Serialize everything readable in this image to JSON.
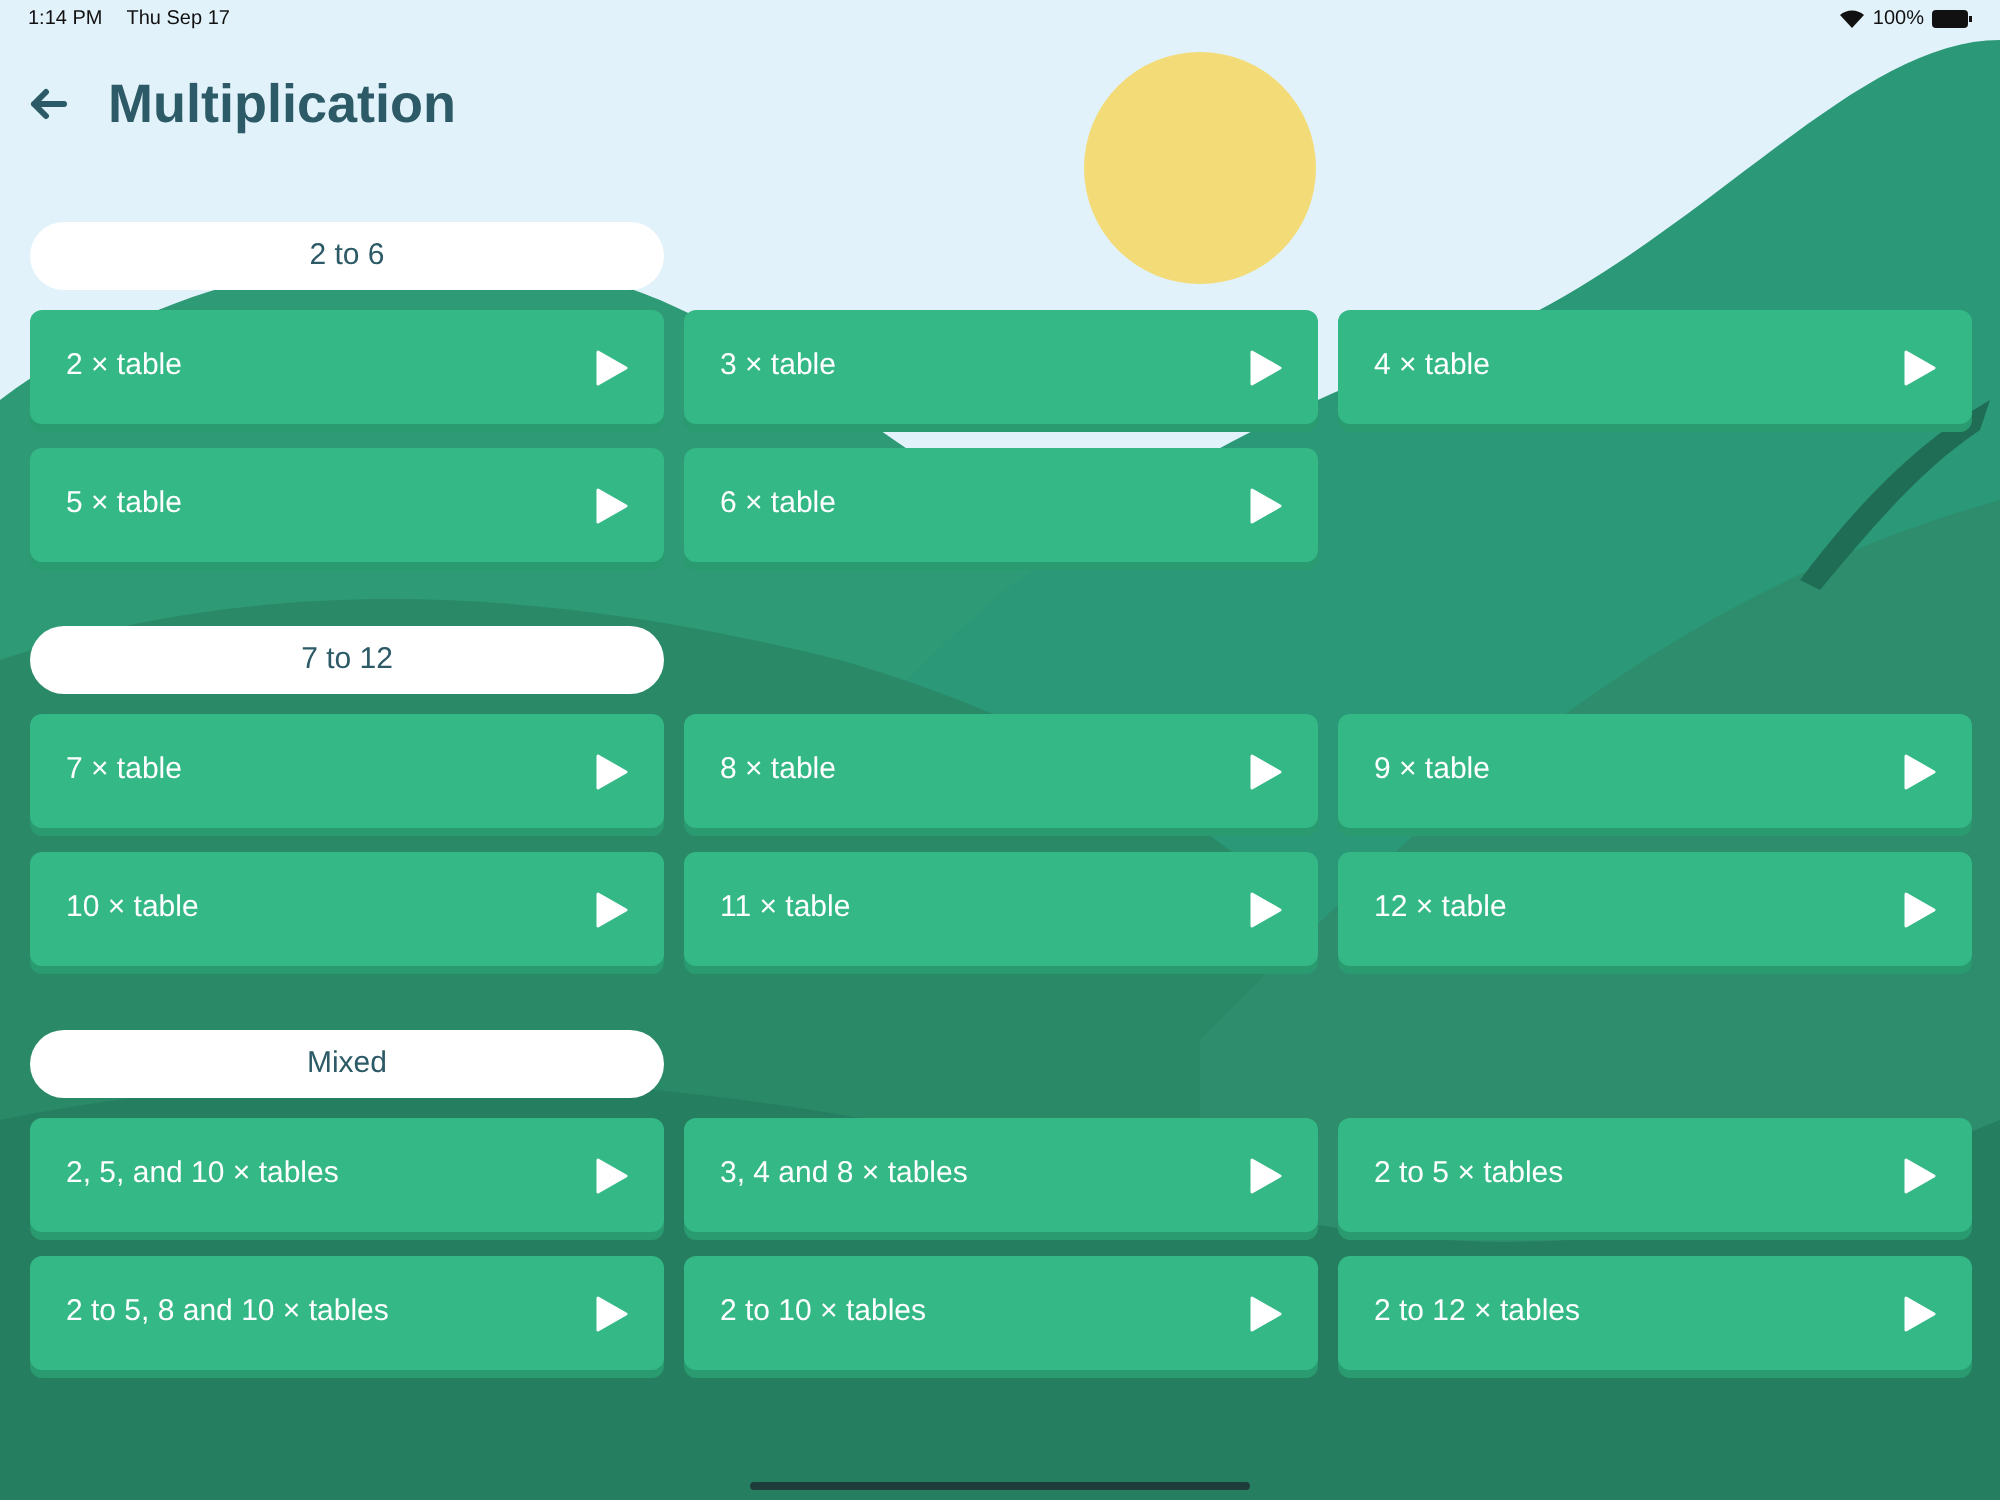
{
  "status_bar": {
    "time": "1:14 PM",
    "date": "Thu Sep 17",
    "battery": "100%"
  },
  "header": {
    "title": "Multiplication"
  },
  "sections": [
    {
      "title": "2 to 6",
      "items": [
        "2 × table",
        "3 × table",
        "4 × table",
        "5 × table",
        "6 × table"
      ]
    },
    {
      "title": "7 to 12",
      "items": [
        "7 × table",
        "8 × table",
        "9 × table",
        "10 × table",
        "11 × table",
        "12 × table"
      ]
    },
    {
      "title": "Mixed",
      "items": [
        "2, 5, and 10 × tables",
        "3, 4 and 8 × tables",
        "2 to 5 × tables",
        "2 to 5, 8 and 10 × tables",
        "2 to 10 × tables",
        "2 to 12 × tables"
      ]
    }
  ]
}
